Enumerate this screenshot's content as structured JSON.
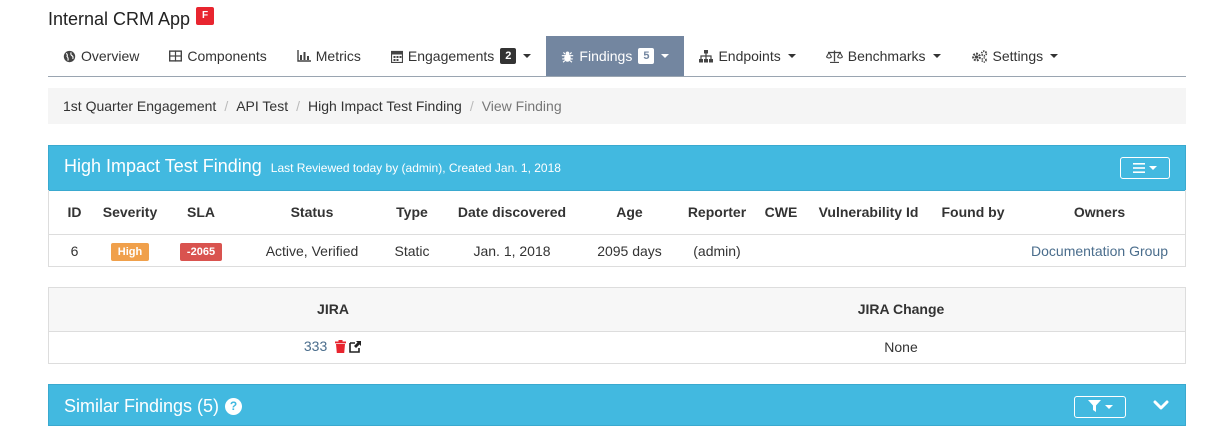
{
  "app": {
    "title": "Internal CRM App",
    "badge": "F"
  },
  "nav": {
    "items": [
      {
        "label": "Overview",
        "icon": "globe-icon"
      },
      {
        "label": "Components",
        "icon": "table-icon"
      },
      {
        "label": "Metrics",
        "icon": "bar-chart-icon"
      },
      {
        "label": "Engagements",
        "icon": "calendar-icon",
        "count": "2"
      },
      {
        "label": "Findings",
        "icon": "bug-icon",
        "count": "5",
        "active": true
      },
      {
        "label": "Endpoints",
        "icon": "sitemap-icon"
      },
      {
        "label": "Benchmarks",
        "icon": "balance-scale-icon"
      },
      {
        "label": "Settings",
        "icon": "cogs-icon"
      }
    ]
  },
  "breadcrumb": [
    "1st Quarter Engagement",
    "API Test",
    "High Impact Test Finding",
    "View Finding"
  ],
  "finding_panel": {
    "title": "High Impact Test Finding",
    "subtitle": "Last Reviewed today by (admin), Created Jan. 1, 2018"
  },
  "finding_table": {
    "headers": [
      "ID",
      "Severity",
      "SLA",
      "Status",
      "Type",
      "Date discovered",
      "Age",
      "Reporter",
      "CWE",
      "Vulnerability Id",
      "Found by",
      "Owners"
    ],
    "row": {
      "id": "6",
      "severity": "High",
      "sla": "-2065",
      "status": "Active, Verified",
      "type": "Static",
      "date_discovered": "Jan. 1, 2018",
      "age": "2095 days",
      "reporter": "(admin)",
      "cwe": "",
      "vulnerability_id": "",
      "found_by": "",
      "owners": "Documentation Group"
    }
  },
  "jira_table": {
    "headers": [
      "JIRA",
      "JIRA Change"
    ],
    "row": {
      "jira": "333",
      "jira_change": "None"
    }
  },
  "similar_panel": {
    "title": "Similar Findings (5)",
    "help": "?"
  },
  "colors": {
    "panel_header": "#42b9e0",
    "nav_active": "#7386a0",
    "severity_high": "#f0a04b",
    "sla_overdue": "#d9534f",
    "delete_icon": "#e8252f"
  }
}
